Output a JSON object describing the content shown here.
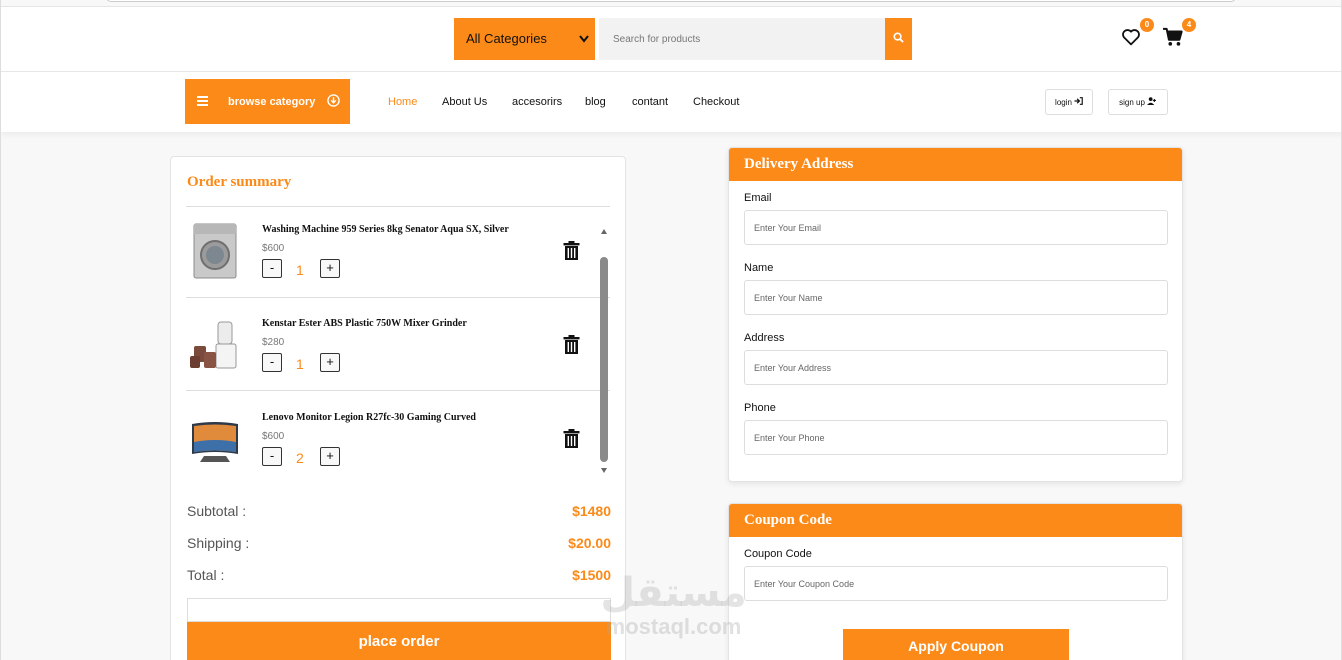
{
  "header": {
    "category_select": "All Categories",
    "search_placeholder": "Search for products",
    "wishlist_count": "0",
    "cart_count": "4"
  },
  "nav": {
    "browse_label": "browse category",
    "links": [
      "Home",
      "About Us",
      "accesorirs",
      "blog",
      "contant",
      "Checkout"
    ],
    "active_link": "Home",
    "login_label": "login",
    "signup_label": "sign up"
  },
  "order": {
    "title": "Order summary",
    "items": [
      {
        "name": "Washing Machine 959 Series 8kg Senator Aqua SX, Silver",
        "price": "$600",
        "qty": "1",
        "image": "washing-machine-image"
      },
      {
        "name": "Kenstar Ester ABS Plastic 750W Mixer Grinder",
        "price": "$280",
        "qty": "1",
        "image": "mixer-grinder-image"
      },
      {
        "name": "Lenovo Monitor Legion R27fc-30 Gaming Curved",
        "price": "$600",
        "qty": "2",
        "image": "curved-monitor-image"
      }
    ],
    "minus_label": "-",
    "plus_label": "+",
    "subtotal_label": "Subtotal :",
    "subtotal_value": "$1480",
    "shipping_label": "Shipping :",
    "shipping_value": "$20.00",
    "total_label": "Total :",
    "total_value": "$1500",
    "place_order_label": "place order"
  },
  "delivery": {
    "title": "Delivery Address",
    "fields": [
      {
        "label": "Email",
        "placeholder": "Enter Your Email"
      },
      {
        "label": "Name",
        "placeholder": "Enter Your Name"
      },
      {
        "label": "Address",
        "placeholder": "Enter Your Address"
      },
      {
        "label": "Phone",
        "placeholder": "Enter Your Phone"
      }
    ]
  },
  "coupon": {
    "title": "Coupon Code",
    "field_label": "Coupon Code",
    "placeholder": "Enter Your Coupon Code",
    "button_label": "Apply Coupon"
  },
  "watermark": {
    "arabic": "مستقل",
    "latin": "mostaql.com"
  },
  "colors": {
    "accent": "#fb8a19"
  }
}
